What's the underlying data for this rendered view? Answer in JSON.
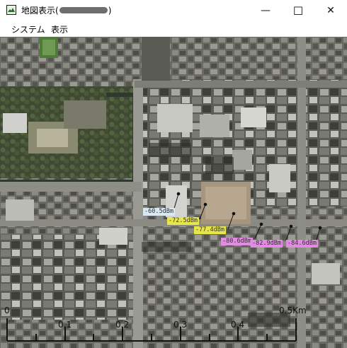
{
  "window": {
    "title_prefix": "地図表示(",
    "title_suffix": ")",
    "minimize_glyph": "—",
    "maximize_glyph": "☐",
    "close_glyph": "✕"
  },
  "menu": {
    "items": [
      {
        "label": "システム"
      },
      {
        "label": "表示"
      }
    ]
  },
  "signal_labels": [
    {
      "text": "-60.5dBm",
      "color": "#d8e8f4"
    },
    {
      "text": "-72.5dBm",
      "color": "#e6e64a"
    },
    {
      "text": "-77.4dBm",
      "color": "#e6e64a"
    },
    {
      "text": "-80.6dBm",
      "color": "#e08ce0"
    },
    {
      "text": "-82.9dBm",
      "color": "#e08ce0"
    },
    {
      "text": "-84.6dBm",
      "color": "#e08ce0"
    }
  ],
  "scale_bar": {
    "start_label": "0",
    "end_label": "0.5Km",
    "ticks": [
      "0.1",
      "0.2",
      "0.3",
      "0.4"
    ]
  }
}
